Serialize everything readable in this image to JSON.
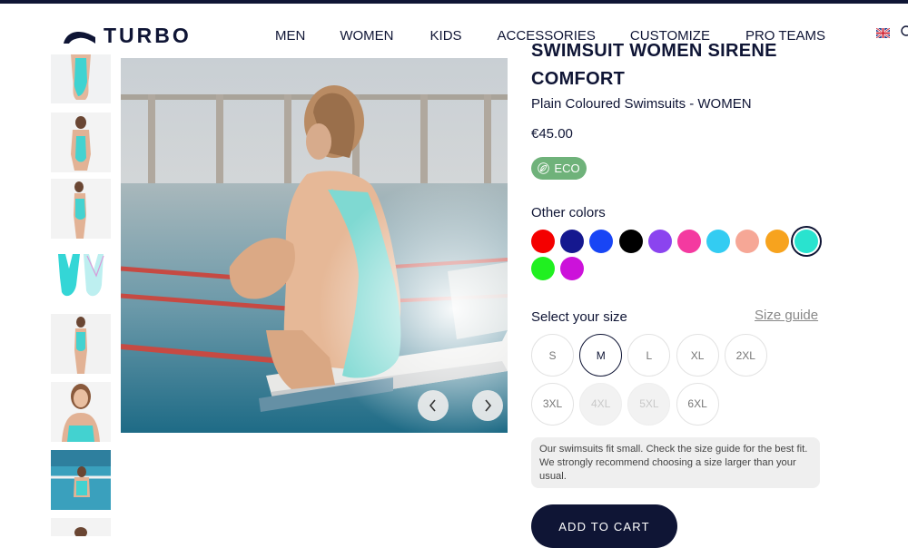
{
  "header": {
    "brand": "TURBO",
    "nav": [
      "MEN",
      "WOMEN",
      "KIDS",
      "ACCESSORIES",
      "CUSTOMIZE",
      "PRO TEAMS"
    ]
  },
  "product": {
    "title_line1_partial": "SWIMSUIT WOMEN SIRENE",
    "title_line2": "COMFORT",
    "subtitle": "Plain Coloured Swimsuits - WOMEN",
    "price": "€45.00",
    "eco_badge": "ECO",
    "other_colors_label": "Other colors",
    "colors": [
      "#f40000",
      "#15188f",
      "#1845f5",
      "#000000",
      "#8b44ef",
      "#f43aa0",
      "#33ccf2",
      "#f6a796",
      "#f7a31e",
      "#29e3cf",
      "#20f020",
      "#cc12da"
    ],
    "selected_color": "#29e3cf",
    "size_label": "Select your size",
    "size_guide": "Size guide",
    "sizes": [
      {
        "label": "S",
        "state": "available"
      },
      {
        "label": "M",
        "state": "selected"
      },
      {
        "label": "L",
        "state": "available"
      },
      {
        "label": "XL",
        "state": "available"
      },
      {
        "label": "2XL",
        "state": "available"
      },
      {
        "label": "3XL",
        "state": "available"
      },
      {
        "label": "4XL",
        "state": "disabled"
      },
      {
        "label": "5XL",
        "state": "disabled"
      },
      {
        "label": "6XL",
        "state": "available"
      }
    ],
    "size_note": "Our swimsuits fit small. Check the size guide for the best fit. We strongly recommend choosing a size larger than your usual.",
    "cart_button": "ADD TO CART"
  },
  "gallery": {
    "thumbnail_count": 8,
    "prev_icon": "chevron-left-icon",
    "next_icon": "chevron-right-icon"
  },
  "colors": {
    "navy": "#0f1535",
    "eco_green": "#6fb27a"
  }
}
